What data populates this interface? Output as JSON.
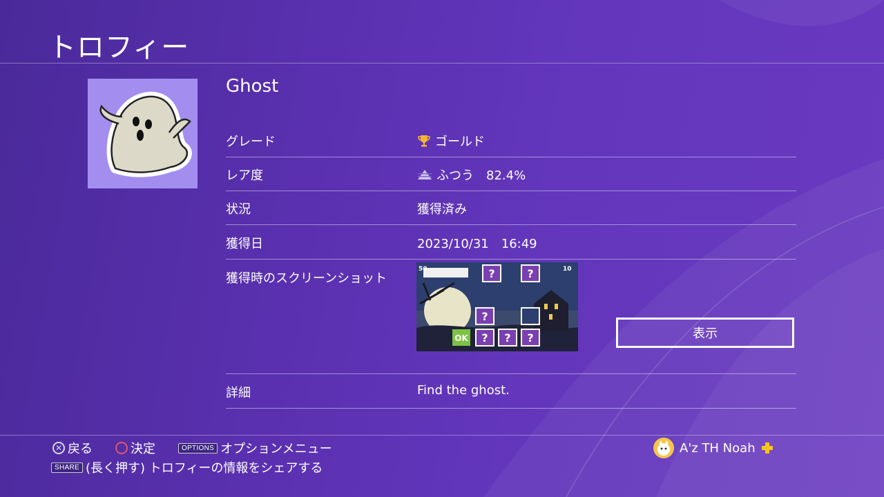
{
  "header": {
    "title": "トロフィー"
  },
  "trophy": {
    "name": "Ghost",
    "icon": "ghost-icon",
    "icon_bg": "#a38ef0"
  },
  "details": {
    "grade_label": "グレード",
    "grade_value": "ゴールド",
    "grade_icon": "gold-trophy-icon",
    "rarity_label": "レア度",
    "rarity_value": "ふつう　82.4%",
    "rarity_icon": "rarity-pyramid-icon",
    "status_label": "状況",
    "status_value": "獲得済み",
    "date_label": "獲得日",
    "date_value": "2023/10/31　16:49",
    "screenshot_label": "獲得時のスクリーンショット",
    "view_button": "表示",
    "detail_label": "詳細",
    "detail_value": "Find the ghost."
  },
  "screenshot": {
    "score_left": "50",
    "score_right": "10",
    "ok_label": "OK",
    "mystery_mark": "?"
  },
  "footer": {
    "back_label": "戻る",
    "confirm_label": "決定",
    "options_key": "OPTIONS",
    "options_label": "オプションメニュー",
    "share_key": "SHARE",
    "share_label": "(長く押す) トロフィーの情報をシェアする"
  },
  "user": {
    "name": "A'z TH Noah",
    "plus_icon": "ps-plus-icon"
  },
  "colors": {
    "background": "#5a30b0",
    "gold": "#f2b632",
    "plus": "#f5c518"
  }
}
